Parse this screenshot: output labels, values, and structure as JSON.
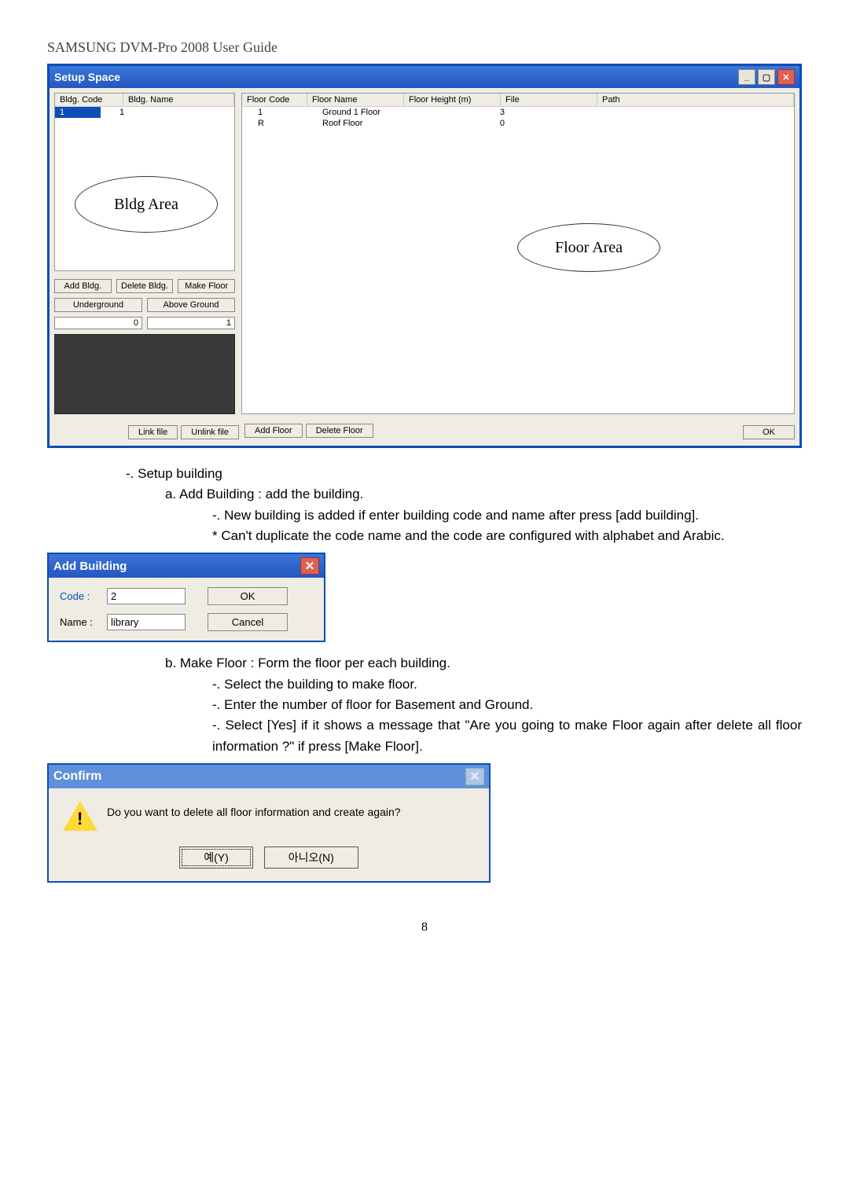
{
  "page_header": "SAMSUNG DVM-Pro 2008 User Guide",
  "page_number": "8",
  "setup_space": {
    "title": "Setup Space",
    "bldg_headers": {
      "code": "Bldg. Code",
      "name": "Bldg. Name"
    },
    "bldg_row": {
      "code": "1",
      "name": "1"
    },
    "callout_bldg": "Bldg Area",
    "btns": {
      "add": "Add Bldg.",
      "del": "Delete Bldg.",
      "make": "Make Floor"
    },
    "fields": {
      "underground": "Underground",
      "above": "Above Ground",
      "ug_val": "0",
      "ag_val": "1"
    },
    "floor_headers": {
      "code": "Floor Code",
      "name": "Floor Name",
      "height": "Floor Height (m)",
      "file": "File",
      "path": "Path"
    },
    "floor_rows": [
      {
        "code": "1",
        "name": "Ground 1 Floor",
        "height": "3",
        "file": "",
        "path": ""
      },
      {
        "code": "R",
        "name": "Roof Floor",
        "height": "0",
        "file": "",
        "path": ""
      }
    ],
    "callout_floor": "Floor Area",
    "bottom": {
      "link": "Link file",
      "unlink": "Unlink file",
      "addfloor": "Add Floor",
      "delfloor": "Delete Floor",
      "ok": "OK"
    }
  },
  "setup_text": {
    "t1": "-. Setup building",
    "t2": "a. Add Building : add the building.",
    "t3": "-. New building is added if enter building code and name after press [add building].",
    "t4": "* Can't duplicate the code name and the code are configured with alphabet and Arabic."
  },
  "add_building": {
    "title": "Add Building",
    "code_label": "Code :",
    "code_val": "2",
    "name_label": "Name :",
    "name_val": "library",
    "ok": "OK",
    "cancel": "Cancel"
  },
  "make_floor_text": {
    "t1": "b. Make Floor : Form the floor per each building.",
    "t2": "-. Select the building to make floor.",
    "t3": "-. Enter the number of floor for Basement and Ground.",
    "t4": "-. Select [Yes] if it shows a message that \"Are you going to make Floor again after delete all floor information ?\"   if press [Make Floor]."
  },
  "confirm": {
    "title": "Confirm",
    "msg": "Do you want to delete all floor information and create again?",
    "yes": "예(Y)",
    "no": "아니오(N)"
  }
}
